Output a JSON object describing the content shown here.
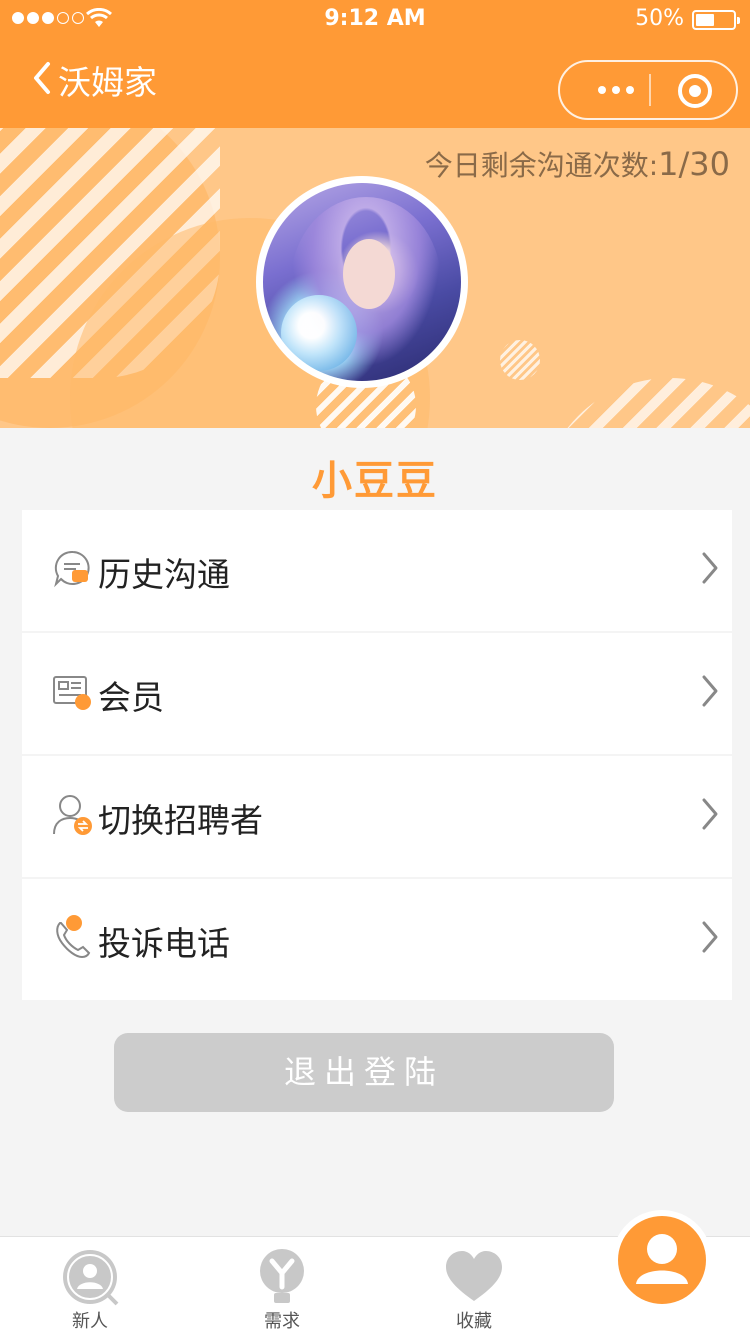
{
  "status": {
    "time": "9:12 AM",
    "battery": "50%"
  },
  "nav": {
    "title": "沃姆家"
  },
  "banner": {
    "remaining_label": "今日剩余沟通次数:",
    "remaining_value": "1/30"
  },
  "profile": {
    "name": "小豆豆"
  },
  "menu": [
    {
      "label": "历史沟通",
      "icon": "chat-history-icon"
    },
    {
      "label": "会员",
      "icon": "member-card-icon"
    },
    {
      "label": "切换招聘者",
      "icon": "switch-recruiter-icon"
    },
    {
      "label": "投诉电话",
      "icon": "complaint-phone-icon"
    }
  ],
  "logout": {
    "label": "退出登陆"
  },
  "tabs": [
    {
      "label": "新人",
      "icon": "new-person-icon"
    },
    {
      "label": "需求",
      "icon": "demand-icon"
    },
    {
      "label": "收藏",
      "icon": "heart-icon"
    },
    {
      "label": "",
      "icon": "profile-icon"
    }
  ],
  "colors": {
    "accent": "#ff9a36",
    "banner": "#ffc788",
    "background": "#f4f4f4",
    "logout": "#cccccc"
  }
}
